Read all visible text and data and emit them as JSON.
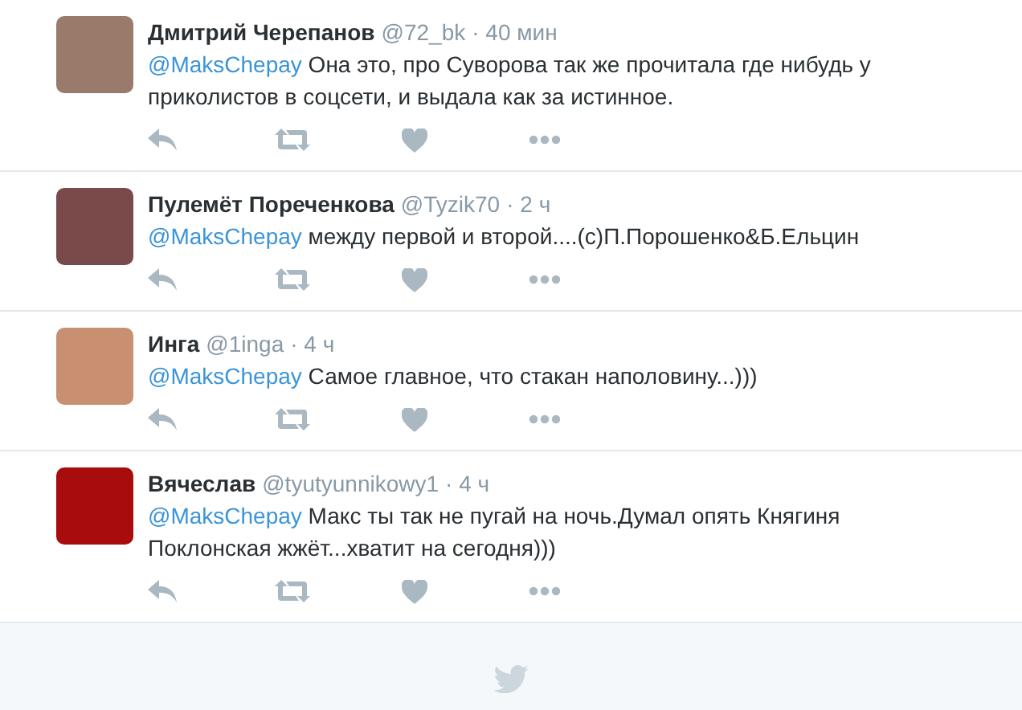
{
  "tweets": [
    {
      "name": "Дмитрий Черепанов",
      "handle": "@72_bk",
      "time": "· 40 мин",
      "mention": "@MaksChepay",
      "text": "Она это, про Суворова так же прочитала где нибудь у приколистов в соцсети, и выдала как за истинное."
    },
    {
      "name": "Пулемёт Пореченкова",
      "handle": "@Tyzik70",
      "time": "· 2 ч",
      "mention": "@MaksChepay",
      "text": "между первой и второй....(с)П.Порошенко&Б.Ельцин"
    },
    {
      "name": "Инга",
      "handle": "@1inga",
      "time": "· 4 ч",
      "mention": "@MaksChepay",
      "text": "Самое главное, что стакан наполовину...)))"
    },
    {
      "name": "Вячеслав",
      "handle": "@tyutyunnikowy1",
      "time": "· 4 ч",
      "mention": "@MaksChepay",
      "text": "Макс ты так не пугай на ночь.Думал опять Княгиня Поклонская жжёт...хватит на сегодня)))"
    }
  ]
}
